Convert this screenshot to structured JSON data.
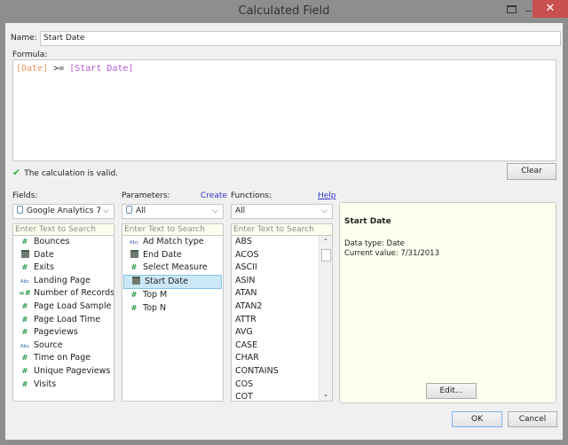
{
  "window": {
    "title": "Calculated Field",
    "close_glyph": "✕"
  },
  "name": {
    "label": "Name:",
    "value": "Start Date"
  },
  "formula": {
    "label": "Formula:",
    "tokens": {
      "field": "[Date]",
      "operator": " >= ",
      "parameter": "[Start Date]"
    },
    "colors": {
      "field": "#e8955a",
      "parameter": "#b45ad2"
    }
  },
  "validation": {
    "icon": "checkmark-icon",
    "message": "The calculation is valid."
  },
  "buttons": {
    "clear": "Clear",
    "edit": "Edit...",
    "ok": "OK",
    "cancel": "Cancel"
  },
  "fields": {
    "label": "Fields:",
    "datasource": "Google Analytics 7",
    "search_placeholder": "Enter Text to Search",
    "items": [
      {
        "type": "number",
        "label": "Bounces"
      },
      {
        "type": "date",
        "label": "Date"
      },
      {
        "type": "number",
        "label": "Exits"
      },
      {
        "type": "string",
        "label": "Landing Page"
      },
      {
        "type": "number-calc",
        "label": "Number of Records"
      },
      {
        "type": "number",
        "label": "Page Load Sample"
      },
      {
        "type": "number",
        "label": "Page Load Time"
      },
      {
        "type": "number",
        "label": "Pageviews"
      },
      {
        "type": "string",
        "label": "Source"
      },
      {
        "type": "number",
        "label": "Time on Page"
      },
      {
        "type": "number",
        "label": "Unique Pageviews"
      },
      {
        "type": "number",
        "label": "Visits"
      }
    ]
  },
  "parameters": {
    "label": "Parameters:",
    "create_link": "Create",
    "filter": "All",
    "search_placeholder": "Enter Text to Search",
    "selected": "Start Date",
    "items": [
      {
        "type": "string",
        "label": "Ad Match type"
      },
      {
        "type": "date",
        "label": "End Date"
      },
      {
        "type": "number",
        "label": "Select Measure"
      },
      {
        "type": "date",
        "label": "Start Date"
      },
      {
        "type": "number",
        "label": "Top M"
      },
      {
        "type": "number",
        "label": "Top N"
      }
    ]
  },
  "functions": {
    "label": "Functions:",
    "help_link": "Help",
    "filter": "All",
    "search_placeholder": "Enter Text to Search",
    "items": [
      "ABS",
      "ACOS",
      "ASCII",
      "ASIN",
      "ATAN",
      "ATAN2",
      "ATTR",
      "AVG",
      "CASE",
      "CHAR",
      "CONTAINS",
      "COS",
      "COT"
    ]
  },
  "description": {
    "title": "Start Date",
    "data_type": "Data type: Date",
    "current_value": "Current value: 7/31/2013"
  }
}
